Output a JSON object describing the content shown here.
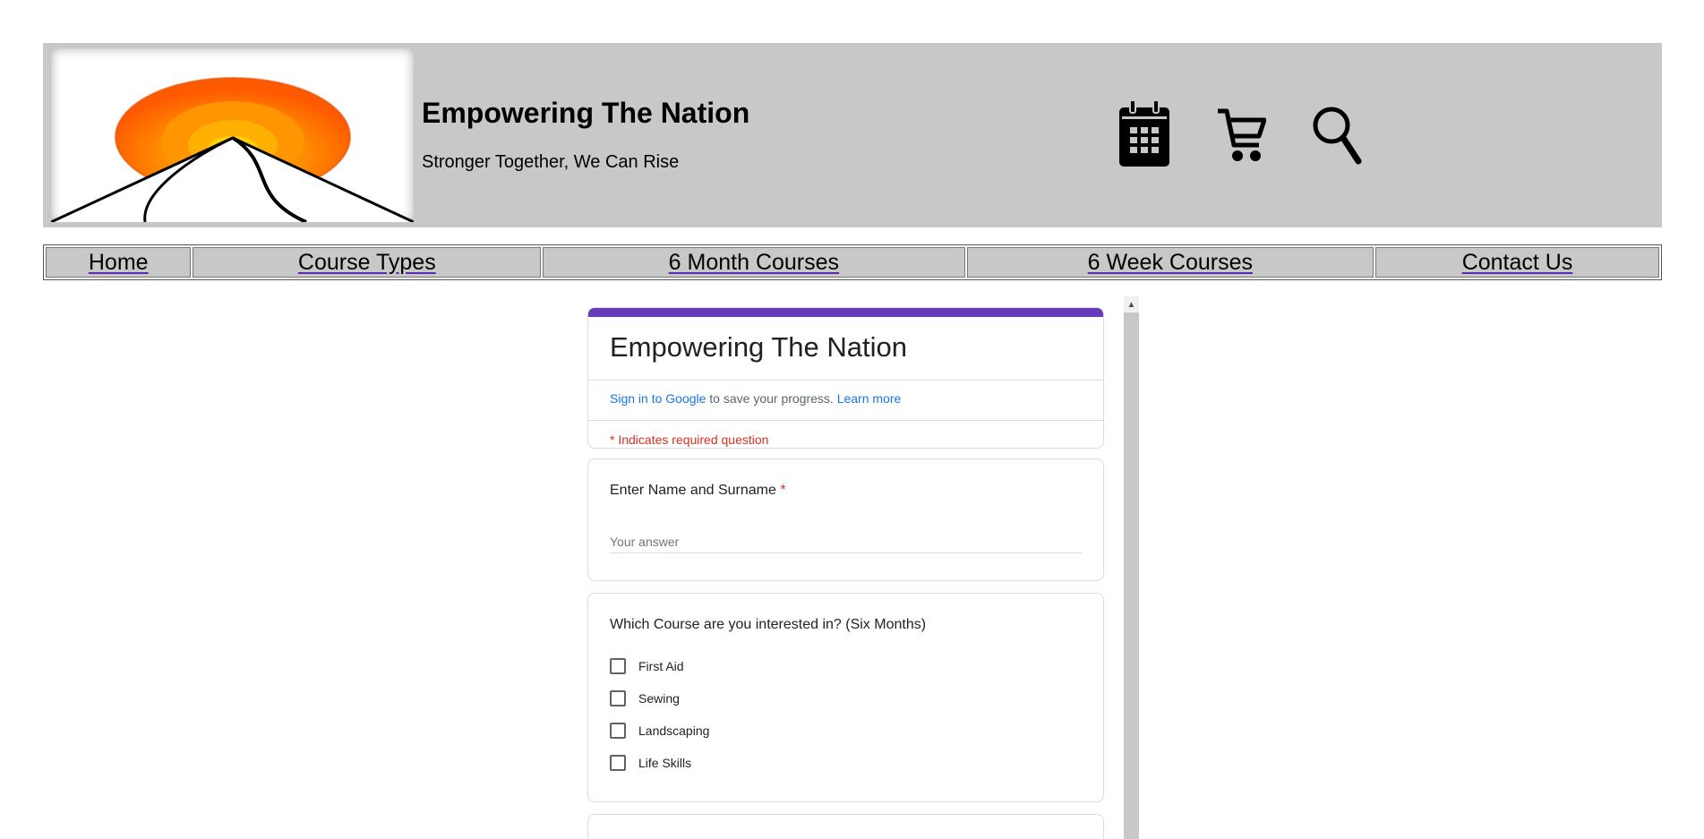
{
  "header": {
    "title": "Empowering The Nation",
    "tagline": "Stronger Together, We Can Rise",
    "icons": [
      "logo-sunrise-icon",
      "calendar-icon",
      "cart-icon",
      "search-icon"
    ]
  },
  "nav": {
    "items": [
      {
        "label": "Home"
      },
      {
        "label": "Course Types"
      },
      {
        "label": "6 Month Courses"
      },
      {
        "label": "6 Week Courses"
      },
      {
        "label": "Contact Us"
      }
    ]
  },
  "form": {
    "accent_color": "#673ab7",
    "title": "Empowering The Nation",
    "signin_link": "Sign in to Google",
    "signin_text": " to save your progress. ",
    "learn_more": "Learn more",
    "required_note": "* Indicates required question",
    "q1": {
      "label": "Enter Name and Surname",
      "required_mark": "*",
      "placeholder": "Your answer"
    },
    "q2": {
      "label": "Which Course are you interested in? (Six Months)",
      "options": [
        "First Aid",
        "Sewing",
        "Landscaping",
        "Life Skills"
      ]
    }
  },
  "colors": {
    "header_bg": "#c8c8c8",
    "required": "#d93025",
    "link": "#1a73e8"
  }
}
